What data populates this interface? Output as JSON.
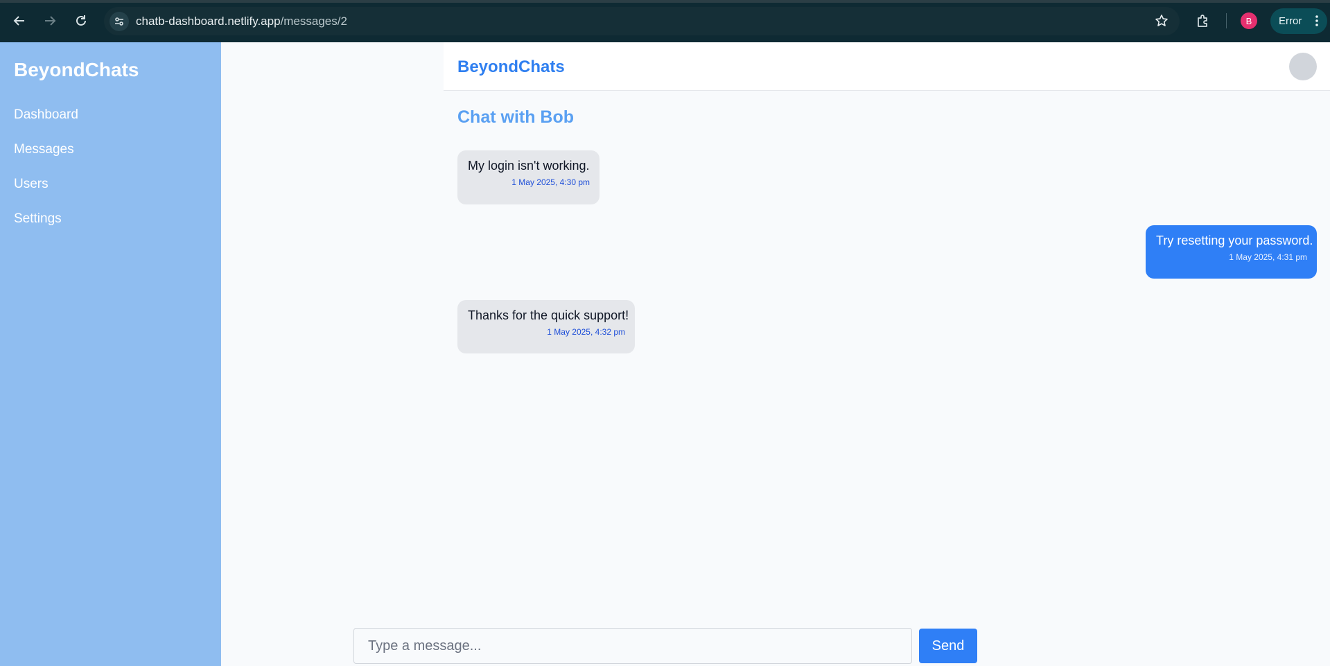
{
  "browser": {
    "url_host": "chatb-dashboard.netlify.app",
    "url_path": "/messages/2",
    "profile_initial": "B",
    "error_label": "Error"
  },
  "sidebar": {
    "brand": "BeyondChats",
    "items": [
      {
        "label": "Dashboard"
      },
      {
        "label": "Messages"
      },
      {
        "label": "Users"
      },
      {
        "label": "Settings"
      }
    ]
  },
  "header": {
    "title": "BeyondChats"
  },
  "chat": {
    "title": "Chat with Bob",
    "messages": [
      {
        "text": "My login isn't working.",
        "time": "1 May 2025, 4:30 pm",
        "direction": "incoming"
      },
      {
        "text": "Try resetting your password.",
        "time": "1 May 2025, 4:31 pm",
        "direction": "outgoing"
      },
      {
        "text": "Thanks for the quick support!",
        "time": "1 May 2025, 4:32 pm",
        "direction": "incoming"
      }
    ]
  },
  "composer": {
    "placeholder": "Type a message...",
    "send_label": "Send"
  },
  "colors": {
    "sidebar_bg": "#8fbdf0",
    "accent": "#2f7ff6",
    "incoming_bubble": "#e5e7eb"
  }
}
